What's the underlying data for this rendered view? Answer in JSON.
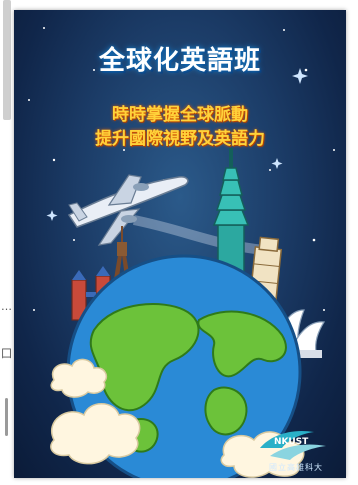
{
  "poster": {
    "title": "全球化英語班",
    "subtitle_line1": "時時掌握全球脈動",
    "subtitle_line2": "提升國際視野及英語力",
    "logo_mark": "NKUST",
    "logo_caption": "國立高雄科大"
  },
  "left_page": {
    "glyph_1": "…",
    "glyph_2": "囗"
  },
  "colors": {
    "background_top": "#10264a",
    "background_glow": "#2b5a8a",
    "title": "#ffffff",
    "subtitle": "#ffd23a",
    "ocean": "#2a8ad6",
    "land": "#6cc23a",
    "cloud": "#fff6e0"
  },
  "icons": [
    "airplane-illustration",
    "globe-illustration",
    "taipei-101-illustration",
    "eiffel-tower-illustration",
    "colosseum-illustration",
    "leaning-tower-illustration",
    "sydney-opera-house-illustration",
    "school-logo"
  ]
}
